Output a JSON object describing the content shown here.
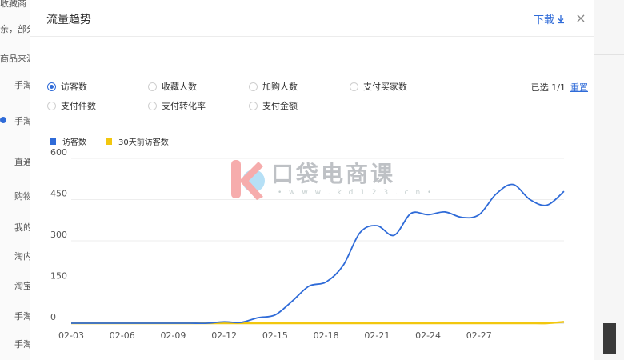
{
  "background": {
    "left_items": [
      "收藏商",
      "亲，部分",
      "商品来源",
      "手淘",
      "手淘",
      "直通",
      "购物",
      "我的",
      "淘内",
      "淘宝",
      "手淘",
      "手淘"
    ]
  },
  "modal": {
    "title": "流量趋势",
    "download_label": "下载",
    "close_label": "×"
  },
  "metrics": [
    {
      "label": "访客数",
      "selected": true
    },
    {
      "label": "收藏人数",
      "selected": false
    },
    {
      "label": "加购人数",
      "selected": false
    },
    {
      "label": "支付买家数",
      "selected": false
    },
    {
      "label": "支付件数",
      "selected": false
    },
    {
      "label": "支付转化率",
      "selected": false
    },
    {
      "label": "支付金额",
      "selected": false
    }
  ],
  "selection": {
    "count_text": "已选 1/1",
    "reset_label": "重置"
  },
  "watermark": {
    "text": "口袋电商课",
    "url": "• w w w . k d 1 2 3 . c n •"
  },
  "chart_data": {
    "type": "line",
    "x_ticks": [
      "02-03",
      "02-06",
      "02-09",
      "02-12",
      "02-15",
      "02-18",
      "02-21",
      "02-24",
      "02-27"
    ],
    "y_ticks": [
      0,
      150,
      300,
      450,
      600
    ],
    "ylim": [
      0,
      600
    ],
    "grid": true,
    "legend_position": "top-left",
    "x": [
      "02-03",
      "02-04",
      "02-05",
      "02-06",
      "02-07",
      "02-08",
      "02-09",
      "02-10",
      "02-11",
      "02-12",
      "02-13",
      "02-14",
      "02-15",
      "02-16",
      "02-17",
      "02-18",
      "02-19",
      "02-20",
      "02-21",
      "02-22",
      "02-23",
      "02-24",
      "02-25",
      "02-26",
      "02-27",
      "02-28",
      "03-01",
      "03-02",
      "03-03",
      "03-04"
    ],
    "series": [
      {
        "name": "访客数",
        "color": "#2f6bd8",
        "values": [
          0,
          0,
          0,
          0,
          0,
          0,
          0,
          0,
          0,
          5,
          3,
          20,
          30,
          80,
          135,
          150,
          210,
          330,
          355,
          320,
          400,
          395,
          405,
          385,
          395,
          470,
          505,
          450,
          430,
          480
        ]
      },
      {
        "name": "30天前访客数",
        "color": "#f2c70e",
        "values": [
          0,
          0,
          0,
          0,
          0,
          0,
          0,
          0,
          0,
          0,
          0,
          0,
          0,
          0,
          0,
          0,
          0,
          0,
          0,
          0,
          0,
          0,
          0,
          0,
          0,
          0,
          0,
          0,
          0,
          5
        ]
      }
    ]
  }
}
